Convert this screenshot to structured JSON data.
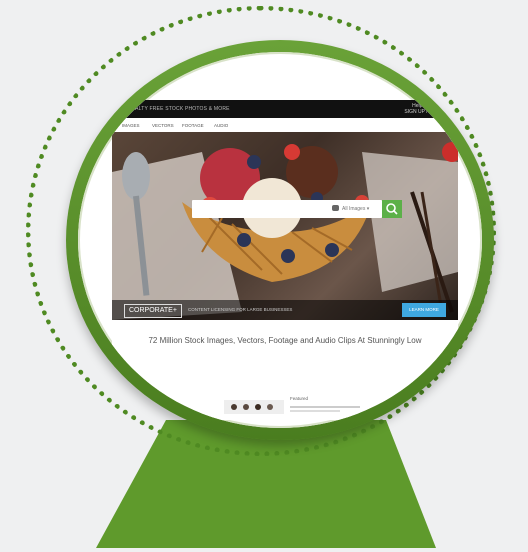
{
  "site": {
    "topbar": {
      "brand": "ROYALTY FREE STOCK PHOTOS & MORE",
      "right_link": "Help & Support",
      "signin": "SIGN UP / LOG IN"
    },
    "nav": [
      "IMAGES",
      "VECTORS",
      "FOOTAGE",
      "AUDIO"
    ],
    "search": {
      "placeholder": "",
      "scope": "All Images ▾"
    },
    "corporate_label": "CORPORATE+",
    "corporate_text": "CONTENT LICENSING FOR LARGE BUSINESSES",
    "learn_more": "LEARN MORE",
    "tagline": "72 Million Stock Images, Vectors, Footage and Audio Clips At Stunningly Low",
    "featured_label": "Featured"
  },
  "colors": {
    "ring": "#4f8a22",
    "lens": "#5a9330",
    "stand": "#5f9a2c",
    "search_button": "#5cb048",
    "learn_button": "#3fa8e0"
  }
}
